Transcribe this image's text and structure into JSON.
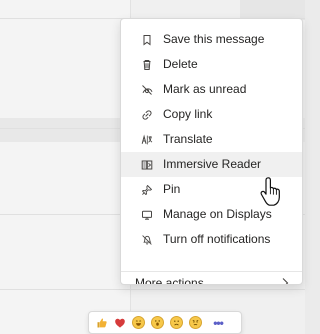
{
  "menu": {
    "items": [
      {
        "label": "Save this message",
        "icon": "bookmark-icon"
      },
      {
        "label": "Delete",
        "icon": "trash-icon"
      },
      {
        "label": "Mark as unread",
        "icon": "unread-icon"
      },
      {
        "label": "Copy link",
        "icon": "link-icon"
      },
      {
        "label": "Translate",
        "icon": "translate-icon"
      },
      {
        "label": "Immersive Reader",
        "icon": "immersive-reader-icon"
      },
      {
        "label": "Pin",
        "icon": "pin-icon"
      },
      {
        "label": "Manage on Displays",
        "icon": "display-icon"
      },
      {
        "label": "Turn off notifications",
        "icon": "notification-off-icon"
      }
    ],
    "more_actions": {
      "label": "More actions",
      "icon": "chevron-right-icon"
    }
  },
  "reactions": {
    "items": [
      {
        "icon": "like-icon"
      },
      {
        "icon": "heart-icon"
      },
      {
        "icon": "laugh-icon"
      },
      {
        "icon": "surprised-icon"
      },
      {
        "icon": "sad-icon"
      },
      {
        "icon": "angry-icon"
      }
    ],
    "more": {
      "label": "•••",
      "icon": "more-options-icon"
    }
  },
  "colors": {
    "background": "#f0f0f0",
    "menu_background": "#ffffff",
    "text": "#252423",
    "accent": "#5b5fc7",
    "like": "#f2b134",
    "heart": "#d63b3b",
    "emoji": "#f7c84a"
  }
}
